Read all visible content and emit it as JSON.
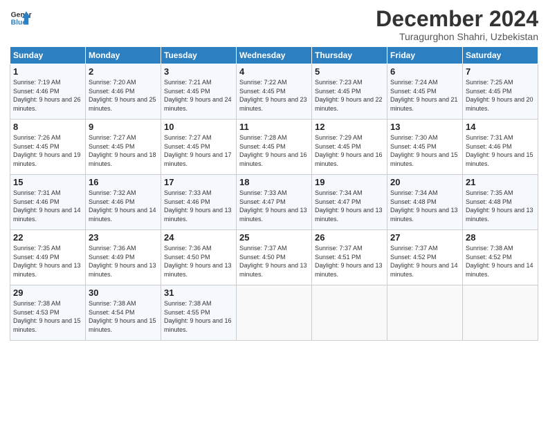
{
  "header": {
    "logo_line1": "General",
    "logo_line2": "Blue",
    "title": "December 2024",
    "subtitle": "Turagurghon Shahri, Uzbekistan"
  },
  "days_of_week": [
    "Sunday",
    "Monday",
    "Tuesday",
    "Wednesday",
    "Thursday",
    "Friday",
    "Saturday"
  ],
  "weeks": [
    [
      {
        "day": "1",
        "sunrise": "Sunrise: 7:19 AM",
        "sunset": "Sunset: 4:46 PM",
        "daylight": "Daylight: 9 hours and 26 minutes."
      },
      {
        "day": "2",
        "sunrise": "Sunrise: 7:20 AM",
        "sunset": "Sunset: 4:46 PM",
        "daylight": "Daylight: 9 hours and 25 minutes."
      },
      {
        "day": "3",
        "sunrise": "Sunrise: 7:21 AM",
        "sunset": "Sunset: 4:45 PM",
        "daylight": "Daylight: 9 hours and 24 minutes."
      },
      {
        "day": "4",
        "sunrise": "Sunrise: 7:22 AM",
        "sunset": "Sunset: 4:45 PM",
        "daylight": "Daylight: 9 hours and 23 minutes."
      },
      {
        "day": "5",
        "sunrise": "Sunrise: 7:23 AM",
        "sunset": "Sunset: 4:45 PM",
        "daylight": "Daylight: 9 hours and 22 minutes."
      },
      {
        "day": "6",
        "sunrise": "Sunrise: 7:24 AM",
        "sunset": "Sunset: 4:45 PM",
        "daylight": "Daylight: 9 hours and 21 minutes."
      },
      {
        "day": "7",
        "sunrise": "Sunrise: 7:25 AM",
        "sunset": "Sunset: 4:45 PM",
        "daylight": "Daylight: 9 hours and 20 minutes."
      }
    ],
    [
      {
        "day": "8",
        "sunrise": "Sunrise: 7:26 AM",
        "sunset": "Sunset: 4:45 PM",
        "daylight": "Daylight: 9 hours and 19 minutes."
      },
      {
        "day": "9",
        "sunrise": "Sunrise: 7:27 AM",
        "sunset": "Sunset: 4:45 PM",
        "daylight": "Daylight: 9 hours and 18 minutes."
      },
      {
        "day": "10",
        "sunrise": "Sunrise: 7:27 AM",
        "sunset": "Sunset: 4:45 PM",
        "daylight": "Daylight: 9 hours and 17 minutes."
      },
      {
        "day": "11",
        "sunrise": "Sunrise: 7:28 AM",
        "sunset": "Sunset: 4:45 PM",
        "daylight": "Daylight: 9 hours and 16 minutes."
      },
      {
        "day": "12",
        "sunrise": "Sunrise: 7:29 AM",
        "sunset": "Sunset: 4:45 PM",
        "daylight": "Daylight: 9 hours and 16 minutes."
      },
      {
        "day": "13",
        "sunrise": "Sunrise: 7:30 AM",
        "sunset": "Sunset: 4:45 PM",
        "daylight": "Daylight: 9 hours and 15 minutes."
      },
      {
        "day": "14",
        "sunrise": "Sunrise: 7:31 AM",
        "sunset": "Sunset: 4:46 PM",
        "daylight": "Daylight: 9 hours and 15 minutes."
      }
    ],
    [
      {
        "day": "15",
        "sunrise": "Sunrise: 7:31 AM",
        "sunset": "Sunset: 4:46 PM",
        "daylight": "Daylight: 9 hours and 14 minutes."
      },
      {
        "day": "16",
        "sunrise": "Sunrise: 7:32 AM",
        "sunset": "Sunset: 4:46 PM",
        "daylight": "Daylight: 9 hours and 14 minutes."
      },
      {
        "day": "17",
        "sunrise": "Sunrise: 7:33 AM",
        "sunset": "Sunset: 4:46 PM",
        "daylight": "Daylight: 9 hours and 13 minutes."
      },
      {
        "day": "18",
        "sunrise": "Sunrise: 7:33 AM",
        "sunset": "Sunset: 4:47 PM",
        "daylight": "Daylight: 9 hours and 13 minutes."
      },
      {
        "day": "19",
        "sunrise": "Sunrise: 7:34 AM",
        "sunset": "Sunset: 4:47 PM",
        "daylight": "Daylight: 9 hours and 13 minutes."
      },
      {
        "day": "20",
        "sunrise": "Sunrise: 7:34 AM",
        "sunset": "Sunset: 4:48 PM",
        "daylight": "Daylight: 9 hours and 13 minutes."
      },
      {
        "day": "21",
        "sunrise": "Sunrise: 7:35 AM",
        "sunset": "Sunset: 4:48 PM",
        "daylight": "Daylight: 9 hours and 13 minutes."
      }
    ],
    [
      {
        "day": "22",
        "sunrise": "Sunrise: 7:35 AM",
        "sunset": "Sunset: 4:49 PM",
        "daylight": "Daylight: 9 hours and 13 minutes."
      },
      {
        "day": "23",
        "sunrise": "Sunrise: 7:36 AM",
        "sunset": "Sunset: 4:49 PM",
        "daylight": "Daylight: 9 hours and 13 minutes."
      },
      {
        "day": "24",
        "sunrise": "Sunrise: 7:36 AM",
        "sunset": "Sunset: 4:50 PM",
        "daylight": "Daylight: 9 hours and 13 minutes."
      },
      {
        "day": "25",
        "sunrise": "Sunrise: 7:37 AM",
        "sunset": "Sunset: 4:50 PM",
        "daylight": "Daylight: 9 hours and 13 minutes."
      },
      {
        "day": "26",
        "sunrise": "Sunrise: 7:37 AM",
        "sunset": "Sunset: 4:51 PM",
        "daylight": "Daylight: 9 hours and 13 minutes."
      },
      {
        "day": "27",
        "sunrise": "Sunrise: 7:37 AM",
        "sunset": "Sunset: 4:52 PM",
        "daylight": "Daylight: 9 hours and 14 minutes."
      },
      {
        "day": "28",
        "sunrise": "Sunrise: 7:38 AM",
        "sunset": "Sunset: 4:52 PM",
        "daylight": "Daylight: 9 hours and 14 minutes."
      }
    ],
    [
      {
        "day": "29",
        "sunrise": "Sunrise: 7:38 AM",
        "sunset": "Sunset: 4:53 PM",
        "daylight": "Daylight: 9 hours and 15 minutes."
      },
      {
        "day": "30",
        "sunrise": "Sunrise: 7:38 AM",
        "sunset": "Sunset: 4:54 PM",
        "daylight": "Daylight: 9 hours and 15 minutes."
      },
      {
        "day": "31",
        "sunrise": "Sunrise: 7:38 AM",
        "sunset": "Sunset: 4:55 PM",
        "daylight": "Daylight: 9 hours and 16 minutes."
      },
      null,
      null,
      null,
      null
    ]
  ]
}
